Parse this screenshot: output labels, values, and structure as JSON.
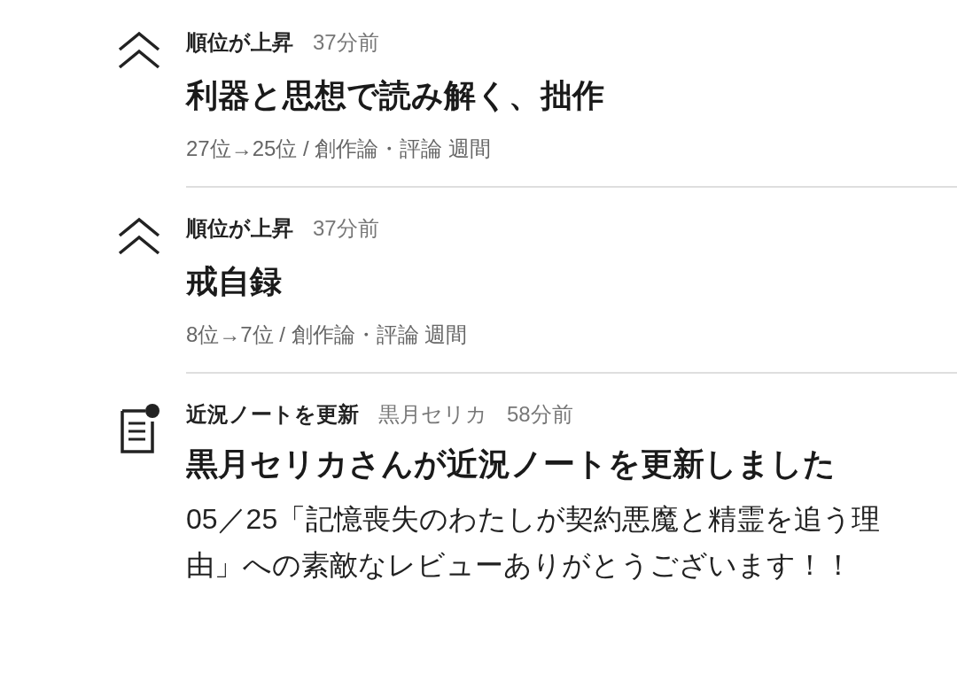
{
  "items": [
    {
      "kind": "rank",
      "label": "順位が上昇",
      "time": "37分前",
      "title": "利器と思想で読み解く、拙作",
      "detail": "27位→25位 / 創作論・評論 週間"
    },
    {
      "kind": "rank",
      "label": "順位が上昇",
      "time": "37分前",
      "title": "戒自録",
      "detail": "8位→7位 / 創作論・評論 週間"
    },
    {
      "kind": "note",
      "label": "近況ノートを更新",
      "author": "黒月セリカ",
      "time": "58分前",
      "title": "黒月セリカさんが近況ノートを更新しました",
      "detail": "05／25「記憶喪失のわたしが契約悪魔と精霊を追う理由」への素敵なレビューありがとうございます！！"
    }
  ]
}
